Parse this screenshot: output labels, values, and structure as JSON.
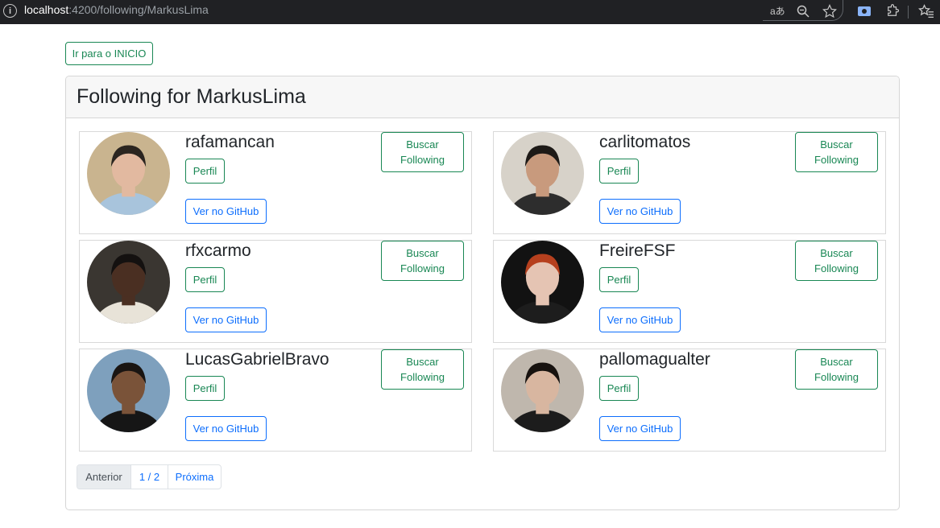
{
  "browser": {
    "url_host": "localhost",
    "url_path": ":4200/following/MarkusLima",
    "icons": [
      "info-icon",
      "translate-icon",
      "zoom-icon",
      "star-icon",
      "screenshot-icon",
      "extensions-icon",
      "favorites-icon"
    ]
  },
  "page": {
    "home_button": "Ir para o INICIO",
    "title": "Following for MarkusLima"
  },
  "users": [
    {
      "login": "rafamancan",
      "perfil": "Perfil",
      "github": "Ver no GitHub",
      "buscar_line1": "Buscar",
      "buscar_line2": "Following",
      "avatar_bg": "#c9b48f",
      "skin": "#e2b9a0",
      "shirt": "#a8c4dc",
      "hair": "#2b2520"
    },
    {
      "login": "carlitomatos",
      "perfil": "Perfil",
      "github": "Ver no GitHub",
      "buscar_line1": "Buscar",
      "buscar_line2": "Following",
      "avatar_bg": "#d7d2c9",
      "skin": "#c89a7d",
      "shirt": "#2d2d2d",
      "hair": "#1e1a17"
    },
    {
      "login": "rfxcarmo",
      "perfil": "Perfil",
      "github": "Ver no GitHub",
      "buscar_line1": "Buscar",
      "buscar_line2": "Following",
      "avatar_bg": "#3a3631",
      "skin": "#4a2f22",
      "shirt": "#e8e3d8",
      "hair": "#141110"
    },
    {
      "login": "FreireFSF",
      "perfil": "Perfil",
      "github": "Ver no GitHub",
      "buscar_line1": "Buscar",
      "buscar_line2": "Following",
      "avatar_bg": "#121212",
      "skin": "#e5c4b3",
      "shirt": "#1d1d1d",
      "hair": "#b6401e"
    },
    {
      "login": "LucasGabrielBravo",
      "perfil": "Perfil",
      "github": "Ver no GitHub",
      "buscar_line1": "Buscar",
      "buscar_line2": "Following",
      "avatar_bg": "#7ea0bd",
      "skin": "#7a5339",
      "shirt": "#161616",
      "hair": "#1a1512"
    },
    {
      "login": "pallomagualter",
      "perfil": "Perfil",
      "github": "Ver no GitHub",
      "buscar_line1": "Buscar",
      "buscar_line2": "Following",
      "avatar_bg": "#bfb7ad",
      "skin": "#d8b6a0",
      "shirt": "#1c1c1c",
      "hair": "#17120f"
    }
  ],
  "pagination": {
    "prev": "Anterior",
    "current": "1 / 2",
    "next": "Próxima"
  },
  "colors": {
    "accent_green": "#198754",
    "accent_blue": "#0d6efd",
    "browser_bar": "#202124"
  }
}
